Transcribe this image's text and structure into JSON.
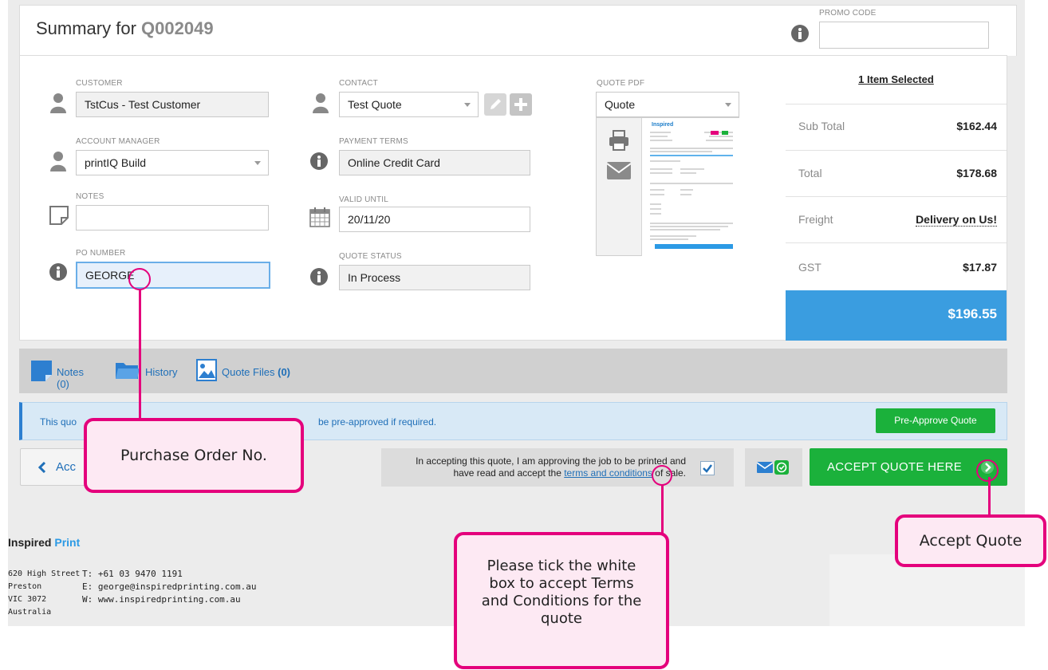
{
  "header": {
    "title_prefix": "Summary for",
    "quote_number": "Q002049",
    "promo_label": "PROMO CODE",
    "promo_value": ""
  },
  "form": {
    "customer": {
      "label": "CUSTOMER",
      "value": "TstCus - Test Customer"
    },
    "contact": {
      "label": "CONTACT",
      "value": "Test Quote"
    },
    "account_manager": {
      "label": "ACCOUNT MANAGER",
      "value": "printIQ Build"
    },
    "payment_terms": {
      "label": "PAYMENT TERMS",
      "value": "Online Credit Card"
    },
    "notes": {
      "label": "NOTES",
      "value": ""
    },
    "valid_until": {
      "label": "VALID UNTIL",
      "value": "20/11/20"
    },
    "po_number": {
      "label": "PO NUMBER",
      "value": "GEORGE"
    },
    "quote_status": {
      "label": "QUOTE STATUS",
      "value": "In Process"
    },
    "quote_pdf": {
      "label": "QUOTE PDF",
      "value": "Quote",
      "thumb_brand": "Inspired"
    }
  },
  "summary": {
    "items_selected": "1 Item Selected",
    "sub_total_label": "Sub Total",
    "sub_total": "$162.44",
    "total_label": "Total",
    "total": "$178.68",
    "freight_label": "Freight",
    "freight": "Delivery on Us!",
    "gst_label": "GST",
    "gst": "$17.87",
    "grand_total": "$196.55"
  },
  "tabs": {
    "notes": "Notes (0)",
    "history": "History",
    "quote_files": "Quote Files",
    "quote_files_count": "(0)"
  },
  "banner": {
    "text_left": "This quo",
    "text_right": "be pre-approved if required.",
    "button": "Pre-Approve Quote"
  },
  "actions": {
    "back_label": "Acc",
    "terms_line1": "In accepting this quote, I am approving the job to be printed and",
    "terms_line2_pre": "have read and accept the",
    "terms_link": "terms and conditions",
    "terms_line2_post": "of sale.",
    "accept_button": "ACCEPT QUOTE HERE"
  },
  "footer": {
    "company_first": "Inspired",
    "company_second": "Print",
    "address": [
      "620 High Street",
      "Preston",
      "VIC 3072",
      "Australia"
    ],
    "phone": "T: +61 03 9470 1191",
    "email": "E: george@inspiredprinting.com.au",
    "web": "W: www.inspiredprinting.com.au"
  },
  "callouts": {
    "po": "Purchase Order No.",
    "terms": "Please tick the white box to accept Terms and Conditions for the quote",
    "accept": "Accept Quote"
  },
  "colors": {
    "accent_blue": "#3a9de0",
    "brand_blue": "#2c9ae5",
    "green": "#1bb13b",
    "callout_pink": "#e4007c"
  }
}
